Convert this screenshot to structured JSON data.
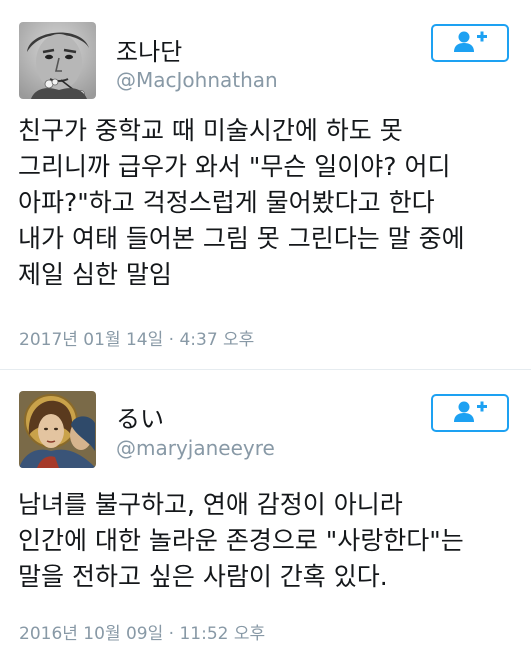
{
  "colors": {
    "accent": "#1da1f2",
    "secondary_text": "#8899a6",
    "primary_text": "#14171a"
  },
  "tweets": [
    {
      "display_name": "조나단",
      "handle": "@MacJohnathan",
      "avatar_icon": "portrait-avatar-grayscale",
      "follow_icon": "follow-person-plus-icon",
      "text_lines": [
        "친구가 중학교 때 미술시간에 하도 못",
        "그리니까 급우가 와서 \"무슨 일이야? 어디",
        "아파?\"하고 걱정스럽게 물어봤다고 한다",
        "내가 여태 들어본 그림 못 그린다는 말 중에",
        "제일 심한 말임"
      ],
      "timestamp": "2017년 01월 14일 · 4:37 오후"
    },
    {
      "display_name": "るい",
      "handle": "@maryjaneeyre",
      "avatar_icon": "medieval-painting-avatar",
      "follow_icon": "follow-person-plus-icon",
      "text_lines": [
        "남녀를 불구하고, 연애 감정이 아니라",
        "인간에 대한 놀라운 존경으로 \"사랑한다\"는",
        "말을 전하고 싶은 사람이 간혹 있다."
      ],
      "timestamp": "2016년 10월 09일 · 11:52 오후"
    }
  ]
}
